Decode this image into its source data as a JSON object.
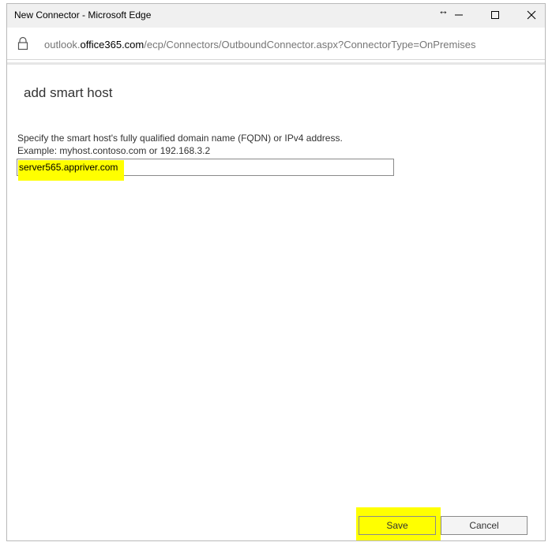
{
  "window": {
    "title": "New Connector - Microsoft Edge"
  },
  "address_bar": {
    "url_prefix": "outlook.",
    "url_domain": "office365.com",
    "url_path": "/ecp/Connectors/OutboundConnector.aspx?ConnectorType=OnPremises"
  },
  "page": {
    "title": "add smart host",
    "instruction": "Specify the smart host's fully qualified domain name (FQDN) or IPv4 address.",
    "example": "Example: myhost.contoso.com or 192.168.3.2",
    "host_value": "server565.appriver.com"
  },
  "buttons": {
    "save_label": "Save",
    "cancel_label": "Cancel"
  },
  "colors": {
    "highlight": "#ffff00",
    "titlebar": "#f0f0f0"
  },
  "icons": [
    "resize-icon",
    "minimize-icon",
    "maximize-icon",
    "close-icon",
    "lock-icon"
  ]
}
